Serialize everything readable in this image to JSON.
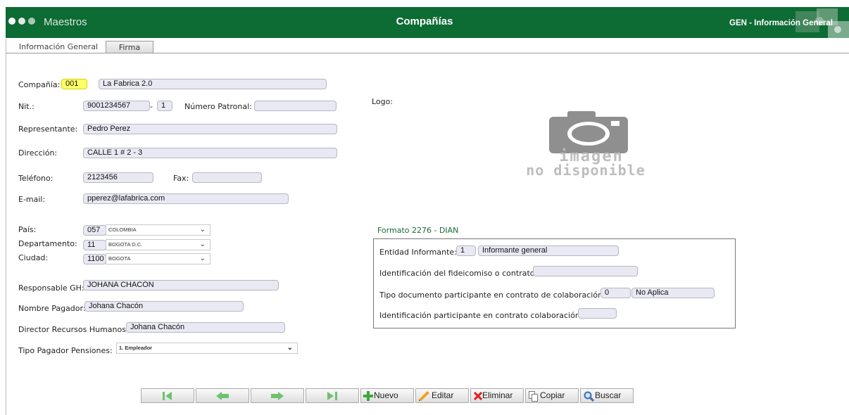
{
  "header": {
    "module": "Maestros",
    "title": "Compañías",
    "section": "GEN - Información General"
  },
  "tabs": [
    {
      "label": "Información General",
      "active": true
    },
    {
      "label": "Firma",
      "active": false
    }
  ],
  "form": {
    "compania_label": "Compañía:",
    "compania_code": "001",
    "compania_name": "La Fabrica 2.0",
    "nit_label": "Nit.:",
    "nit_value": "9001234567",
    "nit_sep": "-",
    "nit_dv": "1",
    "patronal_label": "Número Patronal:",
    "patronal_value": "",
    "representante_label": "Representante:",
    "representante_value": "Pedro Perez",
    "direccion_label": "Dirección:",
    "direccion_value": "CALLE 1 # 2 - 3",
    "telefono_label": "Teléfono:",
    "telefono_value": "2123456",
    "fax_label": "Fax:",
    "fax_value": "",
    "email_label": "E-mail:",
    "email_value": "pperez@lafabrica.com",
    "pais_label": "País:",
    "pais_code": "057",
    "pais_name": "COLOMBIA",
    "depto_label": "Departamento:",
    "depto_code": "11",
    "depto_name": "BOGOTA D.C.",
    "ciudad_label": "Ciudad:",
    "ciudad_code": "1100",
    "ciudad_name": "BOGOTA",
    "responsable_label": "Responsable GH:",
    "responsable_value": "JOHANA CHACÓN",
    "pagador_label": "Nombre Pagador:",
    "pagador_value": "Johana Chacón",
    "director_label": "Director Recursos Humanos:",
    "director_value": "Johana Chacón",
    "tipo_pagador_label": "Tipo Pagador Pensiones:",
    "tipo_pagador_value": "1. Empleador"
  },
  "logo": {
    "label": "Logo:",
    "line1": "imagen",
    "line2": "no disponible"
  },
  "formato": {
    "title": "Formato 2276 - DIAN",
    "entidad_label": "Entidad Informante:",
    "entidad_code": "1",
    "entidad_name": "Informante general",
    "fideicomiso_label": "Identificación del fideicomiso o contrato:",
    "fideicomiso_value": "",
    "tipo_doc_label": "Tipo documento participante en contrato de colaboración:",
    "tipo_doc_code": "0",
    "tipo_doc_name": "No Aplica",
    "ident_part_label": "Identificación participante en contrato colaboración:",
    "ident_part_value": ""
  },
  "toolbar": {
    "nuevo": "Nuevo",
    "editar": "Editar",
    "eliminar": "Eliminar",
    "copiar": "Copiar",
    "buscar": "Buscar"
  },
  "colors": {
    "header_green": "#0d6b34",
    "field_bg": "#e9e9f4",
    "highlight_yellow": "#ffff66",
    "nav_green": "#6cc36c",
    "section_title": "#1a6a3a"
  }
}
